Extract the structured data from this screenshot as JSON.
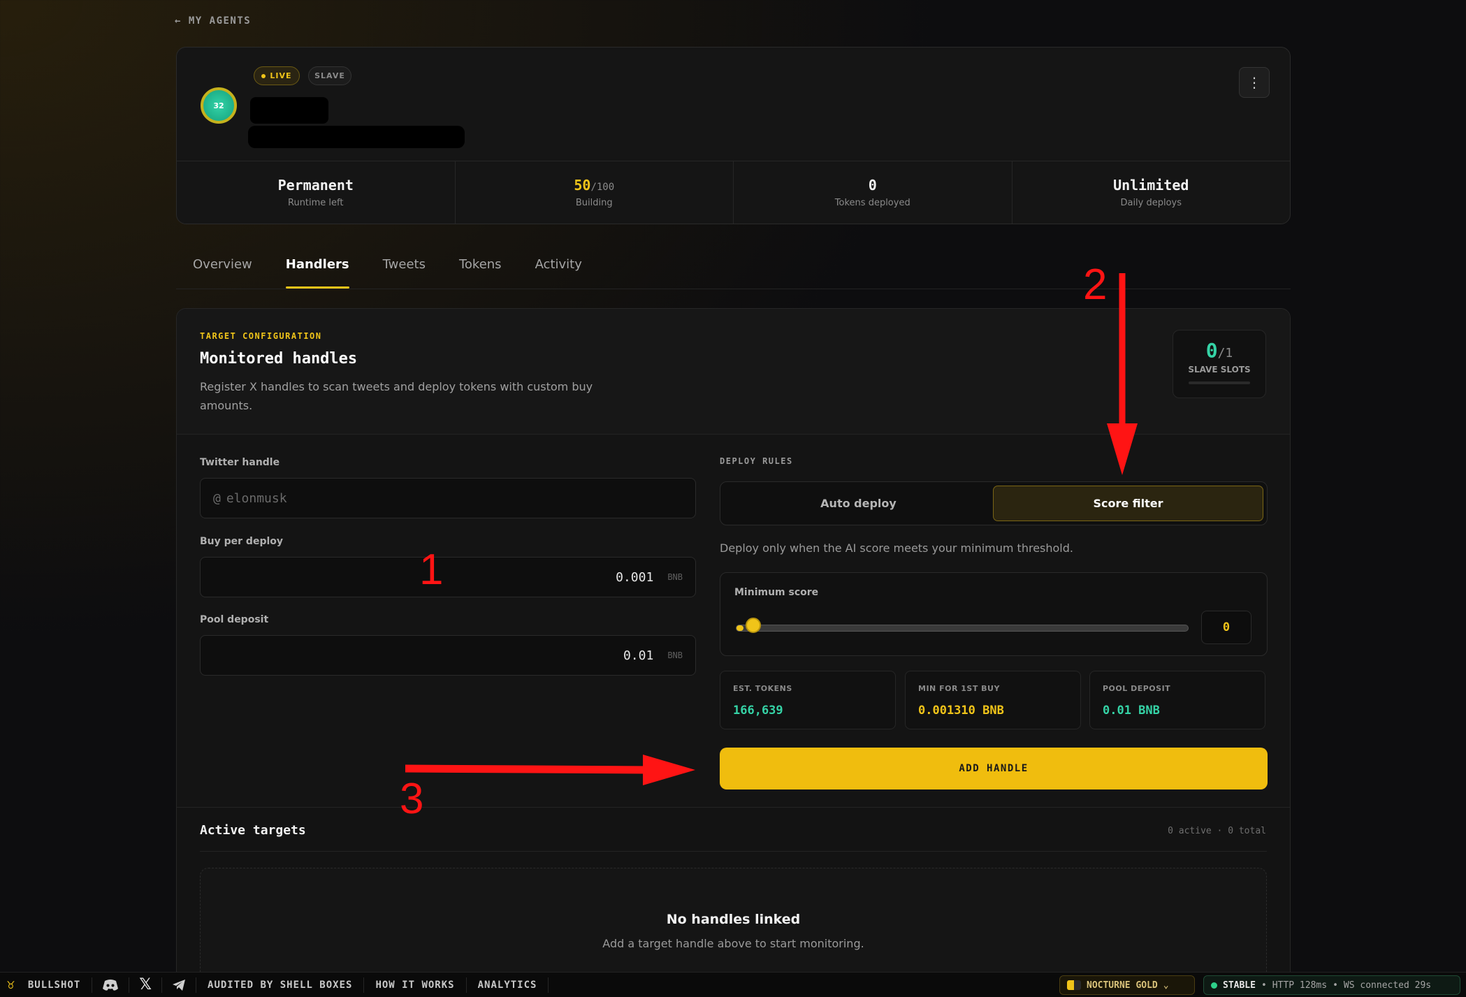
{
  "nav": {
    "back_label": "← MY AGENTS"
  },
  "agent": {
    "avatar_text": "32",
    "badges": {
      "live": "LIVE",
      "slave": "SLAVE"
    },
    "menu_icon": "kebab-icon",
    "stats": [
      {
        "value": "Permanent",
        "label": "Runtime left"
      },
      {
        "value": "50",
        "value_suffix": "/100",
        "label": "Building"
      },
      {
        "value": "0",
        "label": "Tokens deployed"
      },
      {
        "value": "Unlimited",
        "label": "Daily deploys"
      }
    ]
  },
  "tabs": [
    {
      "label": "Overview",
      "active": false
    },
    {
      "label": "Handlers",
      "active": true
    },
    {
      "label": "Tweets",
      "active": false
    },
    {
      "label": "Tokens",
      "active": false
    },
    {
      "label": "Activity",
      "active": false
    }
  ],
  "config": {
    "eyebrow": "TARGET CONFIGURATION",
    "title": "Monitored handles",
    "description": "Register X handles to scan tweets and deploy tokens with custom buy amounts.",
    "slots": {
      "used": "0",
      "total": "/1",
      "label": "SLAVE SLOTS"
    },
    "twitter_handle": {
      "label": "Twitter handle",
      "prefix": "@",
      "placeholder": "elonmusk"
    },
    "buy_per_deploy": {
      "label": "Buy per deploy",
      "value": "0.001",
      "unit": "BNB"
    },
    "pool_deposit": {
      "label": "Pool deposit",
      "value": "0.01",
      "unit": "BNB"
    },
    "deploy_rules": {
      "eyebrow": "DEPLOY RULES",
      "options": [
        "Auto deploy",
        "Score filter"
      ],
      "selected": "Score filter",
      "description": "Deploy only when the AI score meets your minimum threshold."
    },
    "minimum_score": {
      "label": "Minimum score",
      "value": "0",
      "fraction": 0
    },
    "metrics": [
      {
        "label": "EST. TOKENS",
        "value": "166,639",
        "color": "#35d3a6"
      },
      {
        "label": "MIN FOR 1ST BUY",
        "value": "0.001310 BNB",
        "color": "#f0c419"
      },
      {
        "label": "POOL DEPOSIT",
        "value": "0.01 BNB",
        "color": "#35d3a6"
      }
    ],
    "add_button": "ADD HANDLE"
  },
  "active_targets": {
    "title": "Active targets",
    "count": "0 active · 0 total",
    "empty_title": "No handles linked",
    "empty_desc": "Add a target handle above to start monitoring."
  },
  "annotations": {
    "one": "1",
    "two": "2",
    "three": "3",
    "color": "#ff1414"
  },
  "footer": {
    "brand": "BULLSHOT",
    "links": [
      "AUDITED BY SHELL BOXES",
      "HOW IT WORKS",
      "ANALYTICS"
    ],
    "theme": "NOCTURNE GOLD",
    "status": {
      "state": "STABLE",
      "http": "HTTP 128ms",
      "ws": "WS connected 29s"
    }
  },
  "colors": {
    "accent": "#f0c419",
    "success": "#35d3a6",
    "background": "#0d0d0f"
  }
}
